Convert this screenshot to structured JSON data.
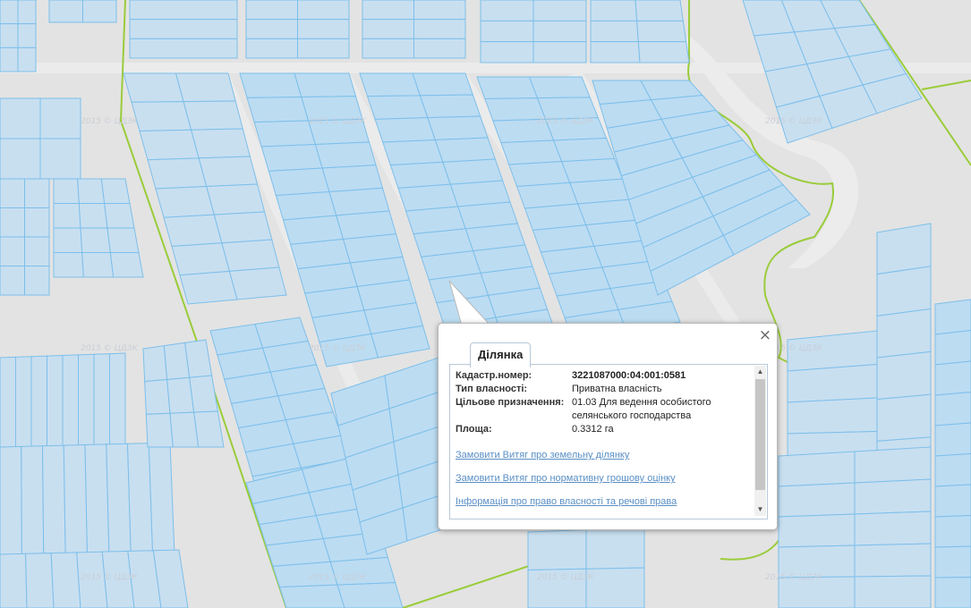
{
  "map": {
    "watermark": "2015 © ЦДЗК",
    "colors": {
      "background": "#e3e3e3",
      "parcel_fill": "#c8dff0",
      "parcel_stroke": "#7dbfea",
      "boundary": "#9acc3a"
    }
  },
  "popup": {
    "tab_label": "Ділянка",
    "close_glyph": "×",
    "fields": [
      {
        "label": "Кадастр.номер:",
        "value": "3221087000:04:001:0581"
      },
      {
        "label": "Тип власності:",
        "value": "Приватна власність"
      },
      {
        "label": "Цільове призначення:",
        "value": "01.03 Для ведення особистого селянського господарства"
      },
      {
        "label": "Площа:",
        "value": "0.3312 га"
      }
    ],
    "links": [
      "Замовити Витяг про земельну ділянку",
      "Замовити Витяг про нормативну грошову оцінку",
      "Інформація про право власності та речові права"
    ],
    "scroll_up_glyph": "▲",
    "scroll_down_glyph": "▼"
  }
}
